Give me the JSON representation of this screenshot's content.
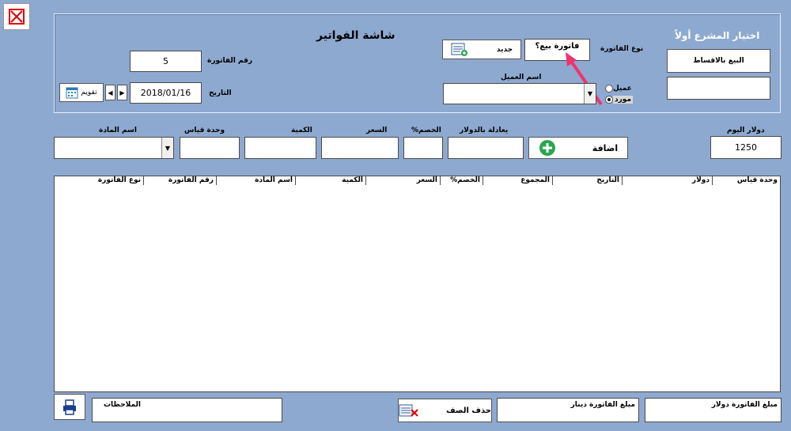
{
  "window": {
    "close_icon": "close-x-icon"
  },
  "header": {
    "title": "شاشة الفواتير",
    "project_prompt": "اختيار المشرع أولاً"
  },
  "invoice": {
    "number_label": "رقم الفاتورة",
    "number_value": "5",
    "date_label": "التاريخ",
    "date_value": "2018/01/16",
    "calendar_label": "تقويم",
    "type_label": "نوع الفاتورة",
    "type_value": "فاتورة بيع؟",
    "new_label": "جديد",
    "customer_label": "اسم العميل",
    "radio_customer": "عميل",
    "radio_supplier": "مورد",
    "project_button": "البيع بالاقساط"
  },
  "entry": {
    "item_name_label": "اسم المادة",
    "unit_label": "وحدة قياس",
    "quantity_label": "الكمية",
    "price_label": "السعر",
    "discount_label": "الخصم%",
    "usd_equiv_label": "يعادلة بالدولار",
    "add_label": "اضافة",
    "dollar_today_label": "دولار اليوم",
    "dollar_today_value": "1250"
  },
  "grid": {
    "columns": [
      "وحدة قياس",
      "دولار",
      "التاريخ",
      "المجموع",
      "الخصم%",
      "السعر",
      "الكمية",
      "اسم المادة",
      "رقم الفاتورة",
      "نوع الفاتورة"
    ]
  },
  "footer": {
    "total_usd_label": "مبلغ الفاتورة دولار",
    "total_dinar_label": "مبلغ الفاتورة دينار",
    "delete_row_label": "حذف الصف",
    "notes_label": "الملاحظات"
  }
}
